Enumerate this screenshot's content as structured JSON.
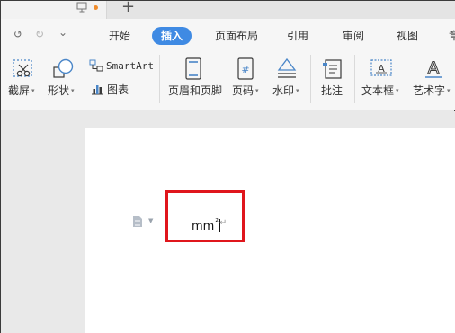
{
  "tabstrip": {
    "new_tab": "+"
  },
  "quick_access": {
    "undo": "↺",
    "redo": "↻",
    "more": "⌄"
  },
  "menu": {
    "items": [
      "开始",
      "插入",
      "页面布局",
      "引用",
      "审阅",
      "视图",
      "章"
    ],
    "active": "插入"
  },
  "ribbon": {
    "screenshot": "截屏",
    "shapes": "形状",
    "smartart": "SmartArt",
    "chart": "图表",
    "header_footer": "页眉和页脚",
    "page_number": "页码",
    "watermark": "水印",
    "comment": "批注",
    "textbox": "文本框",
    "wordart": "艺术字"
  },
  "document": {
    "text": "mm",
    "superscript": "²",
    "paragraph_mark": "↵"
  },
  "colors": {
    "accent": "#3f8ae3",
    "highlight": "#e0161c",
    "tab_dot": "#f08c2c"
  }
}
